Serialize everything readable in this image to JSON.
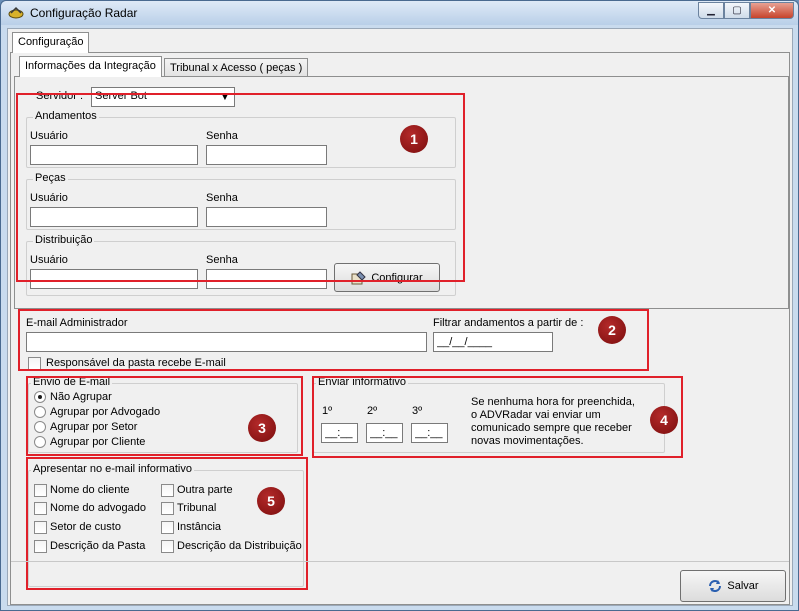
{
  "window": {
    "title": "Configuração Radar",
    "min": "▁",
    "max": "▢",
    "close": "✕"
  },
  "tabs_outer": [
    "Configuração"
  ],
  "tabs_inner": [
    "Informações da Integração",
    "Tribunal x Acesso ( peças )"
  ],
  "servidor": {
    "label": "Servidor :",
    "value": "Server Bot"
  },
  "andamentos": {
    "title": "Andamentos",
    "usuario": "Usuário",
    "senha": "Senha"
  },
  "pecas": {
    "title": "Peças",
    "usuario": "Usuário",
    "senha": "Senha"
  },
  "distribuicao": {
    "title": "Distribuição",
    "usuario": "Usuário",
    "senha": "Senha"
  },
  "configurar": "Configurar",
  "email": {
    "label": "E-mail Administrador",
    "filtrar_label": "Filtrar andamentos a partir de :",
    "filtrar_value": "__/__/____",
    "responsavel": "Responsável da pasta recebe E-mail"
  },
  "envio": {
    "title": "Envio de E-mail",
    "options": [
      "Não Agrupar",
      "Agrupar por Advogado",
      "Agrupar por Setor",
      "Agrupar por Cliente"
    ]
  },
  "informativo": {
    "title": "Enviar informativo",
    "h1": "1º",
    "h2": "2º",
    "h3": "3º",
    "time_value": "__:__",
    "note": "Se nenhuma hora for preenchida, o ADVRadar vai enviar um comunicado sempre que receber novas movimentações."
  },
  "apresentar": {
    "title": "Apresentar no e-mail informativo",
    "left": [
      "Nome do cliente",
      "Nome do advogado",
      "Setor de custo",
      "Descrição da Pasta"
    ],
    "right": [
      "Outra parte",
      "Tribunal",
      "Instância",
      "Descrição da Distribuição"
    ]
  },
  "badges": [
    "1",
    "2",
    "3",
    "4",
    "5"
  ],
  "salvar": "Salvar",
  "colors": {
    "highlight": "#e0202a",
    "badge": "#8b1414"
  }
}
